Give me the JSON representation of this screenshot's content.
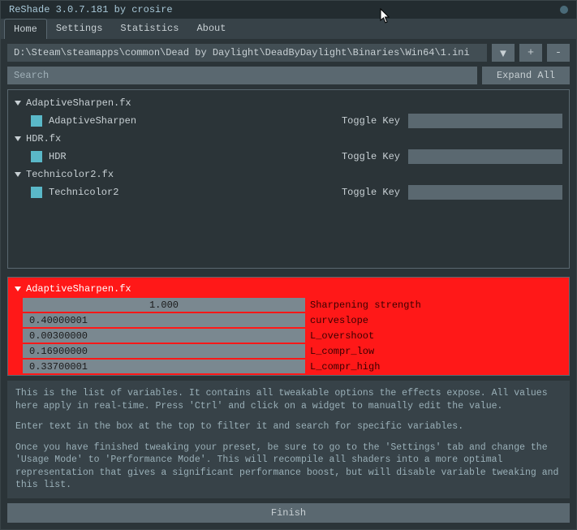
{
  "window": {
    "title": "ReShade 3.0.7.181 by crosire"
  },
  "tabs": {
    "home": "Home",
    "settings": "Settings",
    "statistics": "Statistics",
    "about": "About"
  },
  "path": "D:\\Steam\\steamapps\\common\\Dead by Daylight\\DeadByDaylight\\Binaries\\Win64\\1.ini",
  "path_buttons": {
    "dropdown": "▼",
    "plus": "+",
    "minus": "-"
  },
  "search": {
    "placeholder": "Search",
    "expand": "Expand All"
  },
  "effects": [
    {
      "file": "AdaptiveSharpen.fx",
      "name": "AdaptiveSharpen",
      "toggle_label": "Toggle Key"
    },
    {
      "file": "HDR.fx",
      "name": "HDR",
      "toggle_label": "Toggle Key"
    },
    {
      "file": "Technicolor2.fx",
      "name": "Technicolor2",
      "toggle_label": "Toggle Key"
    }
  ],
  "vars": {
    "header": "AdaptiveSharpen.fx",
    "rows": [
      {
        "value": "1.000",
        "label": "Sharpening strength",
        "center": true
      },
      {
        "value": "0.40000001",
        "label": "curveslope"
      },
      {
        "value": "0.00300000",
        "label": "L_overshoot"
      },
      {
        "value": "0.16900000",
        "label": "L_compr_low"
      },
      {
        "value": "0.33700001",
        "label": "L_compr_high"
      }
    ]
  },
  "help": {
    "p1": "This is the list of variables. It contains all tweakable options the effects expose. All values here apply in real-time. Press 'Ctrl' and click on a widget to manually edit the value.",
    "p2": "Enter text in the box at the top to filter it and search for specific variables.",
    "p3": "Once you have finished tweaking your preset, be sure to go to the 'Settings' tab and change the 'Usage Mode' to 'Performance Mode'. This will recompile all shaders into a more optimal representation that gives a significant performance boost, but will disable variable tweaking and this list."
  },
  "finish": "Finish"
}
